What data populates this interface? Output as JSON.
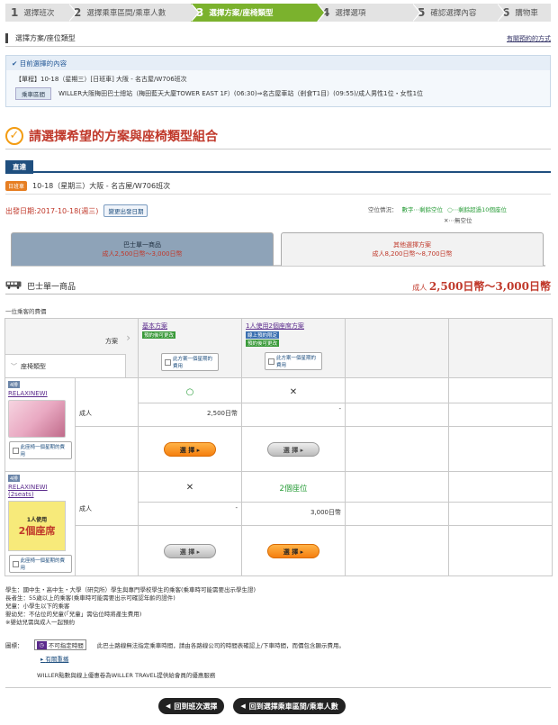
{
  "steps": [
    {
      "num": "1",
      "label": "選擇班次"
    },
    {
      "num": "2",
      "label": "選擇乘車區間/乘車人數"
    },
    {
      "num": "3",
      "label": "選擇方案/座椅類型"
    },
    {
      "num": "4",
      "label": "選擇選項"
    },
    {
      "num": "5",
      "label": "確認選擇內容"
    },
    {
      "num": "6",
      "label": "購物車"
    }
  ],
  "section": {
    "title": "選擇方案/座位類型",
    "help_link": "有關預約的方式"
  },
  "current": {
    "header": "目前選擇的內容",
    "line1": "【單程】10-18（星期三）[日班車] 大阪 - 名古屋/W706班次",
    "tag": "乘車區間",
    "line2": "WILLER大阪梅田巴士總站（梅田藍天大廈TOWER EAST 1F）(06:30)⇒名古屋車站（剎食T1目）(09:55)/成人男性1位・女性1位"
  },
  "main_title": "請選擇希望的方案與座椅類型組合",
  "direct_label": "直達",
  "trip": {
    "badge": "日班車",
    "text": "10-18（星期三）大阪 - 名古屋/W706班次"
  },
  "departure": {
    "label": "出發日期:2017-10-18(週三)",
    "change_button": "變更出發日期"
  },
  "legend": {
    "label": "空位情況：",
    "num_label": "數字⋯剩餘空位",
    "circle_label": "○⋯剩餘超過10個座位",
    "cross_label": "✕⋯無空位"
  },
  "tabs": [
    {
      "name": "巴士單一商品",
      "price": "成人2,500日幣～3,000日幣"
    },
    {
      "name": "其他選擇方案",
      "price": "成人8,200日幣～8,700日幣"
    }
  ],
  "product": {
    "name": "巴士單一商品",
    "price_prefix": "成人",
    "price": "2,500日幣～3,000日幣"
  },
  "per_person": "一位乘客的費價",
  "table": {
    "plan_header": "方案",
    "seat_header": "座椅類型",
    "calendar_button": "此方案一個星期的費用",
    "plans": [
      {
        "name": "基本方案",
        "tags": [
          "預約後可更改"
        ]
      },
      {
        "name": "1人使用2個座席方案",
        "tags": [
          "線上預約限定",
          "預約後可更改"
        ]
      }
    ],
    "rows": [
      {
        "no": "4排",
        "seat": "RELAXINEWI",
        "passenger": "成人",
        "avail": [
          "○",
          "✕"
        ],
        "price": [
          "2,500日幣",
          "-"
        ],
        "calendar_button": "此座椅一個星期的費用"
      },
      {
        "no": "4排",
        "seat": "RELAXINEWI (2seats)",
        "passenger": "成人",
        "avail": [
          "✕",
          "2個座位"
        ],
        "price": [
          "-",
          "3,000日幣"
        ],
        "calendar_button": "此座椅一個星期的費用",
        "image_label1": "1人使用",
        "image_label2": "2個座席"
      }
    ],
    "select_button": "選 擇"
  },
  "notes": [
    "學生：國中生・高中生・大學（研究所）學生與專門學校學生的乘客(乘車時可能需要出示學生證)",
    "長者生：55歲以上的乘客(乘車時可能需要出示可確認年齡的證件)",
    "兒童：小學生以下的乘客",
    "嬰幼兒：不佔位的兒童(「兒童」需佔位時將產生費用)",
    "※嬰幼兒需與成人一起預約"
  ],
  "legend2": {
    "label": "圖標：",
    "tag": "不可指定時間",
    "tag_text": "此巴士路線無法指定乘車時間，請由各路線公司的時間表確認上/下車時間，而價包含顯示費用。",
    "link": "有關重播",
    "line3": "WILLER點數與線上優惠卷為WILLER TRAVEL提供給會員的優惠服務"
  },
  "nav": {
    "back_trip": "回到班次選擇",
    "back_section": "回到選擇乘車區間/乘車人數"
  }
}
